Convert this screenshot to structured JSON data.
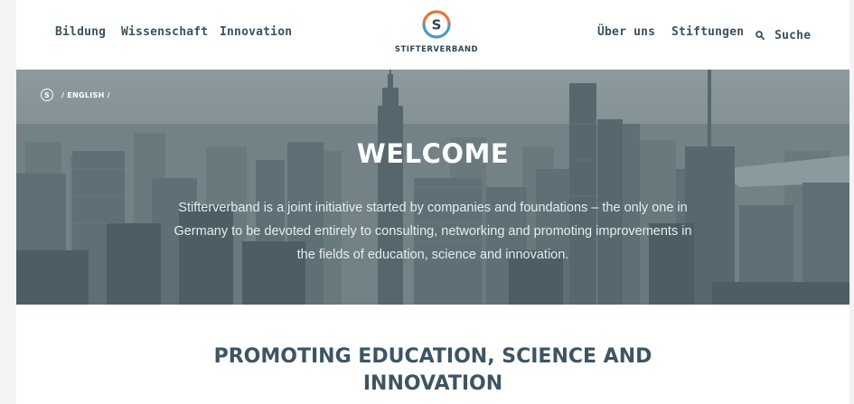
{
  "header": {
    "nav_left": [
      "Bildung",
      "Wissenschaft",
      "Innovation"
    ],
    "nav_right": [
      "Über uns",
      "Stiftungen"
    ],
    "search_label": "Suche",
    "logo_letter": "S",
    "logo_text": "STIFTERVERBAND"
  },
  "hero": {
    "breadcrumb_home": "S",
    "breadcrumb_current": "ENGLISH",
    "breadcrumb_sep": "/",
    "title": "WELCOME",
    "text": "Stifterverband is a joint initiative started by companies and foundations – the only one in Germany to be devoted entirely to consulting, networking and promoting improvements in the fields of education, science and innovation."
  },
  "section": {
    "title": "PROMOTING EDUCATION, SCIENCE AND INNOVATION"
  },
  "colors": {
    "nav_text": "#3b5260",
    "logo_orange": "#e8743b",
    "logo_blue": "#4b9ac9",
    "heading": "#3d5563"
  }
}
